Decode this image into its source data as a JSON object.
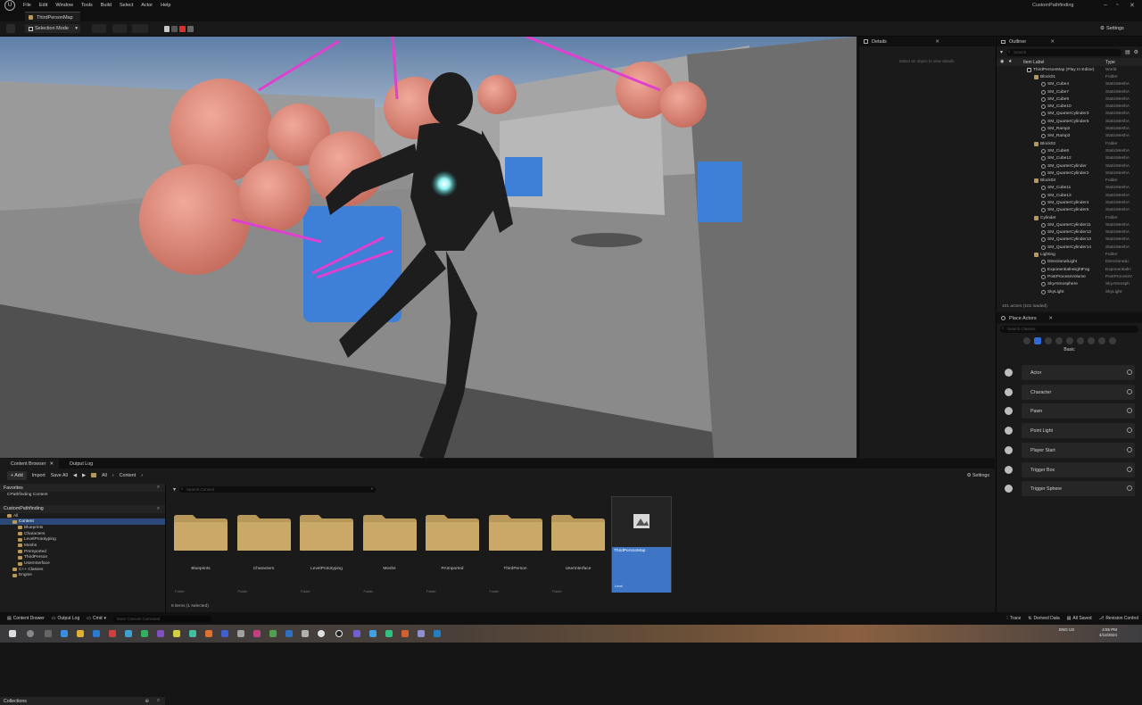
{
  "menubar": {
    "logo": "U",
    "items": [
      "File",
      "Edit",
      "Window",
      "Tools",
      "Build",
      "Select",
      "Actor",
      "Help"
    ],
    "project_name": "CustomPathfinding"
  },
  "tab": {
    "label": "ThirdPersonMap"
  },
  "toolbar": {
    "selection_mode": "Selection Mode",
    "settings": "Settings"
  },
  "details": {
    "title": "Details",
    "hint": "Select an object to view details."
  },
  "outliner": {
    "title": "Outliner",
    "search_placeholder": "Search",
    "col_label": "Item Label",
    "col_type": "Type",
    "rows": [
      {
        "label": "ThirdPersonMap (Play In Editor)",
        "type": "World",
        "indent": 0,
        "icon": "world"
      },
      {
        "label": "Block01",
        "type": "Folder",
        "indent": 1,
        "icon": "folder"
      },
      {
        "label": "SM_Cube4",
        "type": "StaticMeshA",
        "indent": 2,
        "icon": "mesh"
      },
      {
        "label": "SM_Cube7",
        "type": "StaticMeshA",
        "indent": 2,
        "icon": "mesh"
      },
      {
        "label": "SM_Cube9",
        "type": "StaticMeshA",
        "indent": 2,
        "icon": "mesh"
      },
      {
        "label": "SM_Cube10",
        "type": "StaticMeshA",
        "indent": 2,
        "icon": "mesh"
      },
      {
        "label": "SM_QuarterCylinder3",
        "type": "StaticMeshA",
        "indent": 2,
        "icon": "mesh"
      },
      {
        "label": "SM_QuarterCylinder5",
        "type": "StaticMeshA",
        "indent": 2,
        "icon": "mesh"
      },
      {
        "label": "SM_Ramp2",
        "type": "StaticMeshA",
        "indent": 2,
        "icon": "mesh"
      },
      {
        "label": "SM_Ramp3",
        "type": "StaticMeshA",
        "indent": 2,
        "icon": "mesh"
      },
      {
        "label": "Block02",
        "type": "Folder",
        "indent": 1,
        "icon": "folder"
      },
      {
        "label": "SM_Cube8",
        "type": "StaticMeshA",
        "indent": 2,
        "icon": "mesh"
      },
      {
        "label": "SM_Cube12",
        "type": "StaticMeshA",
        "indent": 2,
        "icon": "mesh"
      },
      {
        "label": "SM_QuarterCylinder",
        "type": "StaticMeshA",
        "indent": 2,
        "icon": "mesh"
      },
      {
        "label": "SM_QuarterCylinder2",
        "type": "StaticMeshA",
        "indent": 2,
        "icon": "mesh"
      },
      {
        "label": "Block03",
        "type": "Folder",
        "indent": 1,
        "icon": "folder"
      },
      {
        "label": "SM_Cube11",
        "type": "StaticMeshA",
        "indent": 2,
        "icon": "mesh"
      },
      {
        "label": "SM_Cube13",
        "type": "StaticMeshA",
        "indent": 2,
        "icon": "mesh"
      },
      {
        "label": "SM_QuarterCylinder4",
        "type": "StaticMeshA",
        "indent": 2,
        "icon": "mesh"
      },
      {
        "label": "SM_QuarterCylinder5",
        "type": "StaticMeshA",
        "indent": 2,
        "icon": "mesh"
      },
      {
        "label": "Cylinder",
        "type": "Folder",
        "indent": 1,
        "icon": "folder"
      },
      {
        "label": "SM_QuarterCylinder11",
        "type": "StaticMeshA",
        "indent": 2,
        "icon": "mesh"
      },
      {
        "label": "SM_QuarterCylinder12",
        "type": "StaticMeshA",
        "indent": 2,
        "icon": "mesh"
      },
      {
        "label": "SM_QuarterCylinder13",
        "type": "StaticMeshA",
        "indent": 2,
        "icon": "mesh"
      },
      {
        "label": "SM_QuarterCylinder14",
        "type": "StaticMeshA",
        "indent": 2,
        "icon": "mesh"
      },
      {
        "label": "Lighting",
        "type": "Folder",
        "indent": 1,
        "icon": "folder"
      },
      {
        "label": "DirectionalLight",
        "type": "DirectionalLi",
        "indent": 2,
        "icon": "mesh"
      },
      {
        "label": "ExponentialHeightFog",
        "type": "ExponentialH",
        "indent": 2,
        "icon": "mesh"
      },
      {
        "label": "PostProcessVolume",
        "type": "PostProcessV",
        "indent": 2,
        "icon": "mesh"
      },
      {
        "label": "SkyAtmosphere",
        "type": "SkyAtmosph",
        "indent": 2,
        "icon": "mesh"
      },
      {
        "label": "SkyLight",
        "type": "SkyLight",
        "indent": 2,
        "icon": "mesh"
      }
    ],
    "status": "101 actors (101 loaded)"
  },
  "place_actors": {
    "title": "Place Actors",
    "search_placeholder": "Search Classes",
    "category": "Basic",
    "items": [
      "Actor",
      "Character",
      "Pawn",
      "Point Light",
      "Player Start",
      "Trigger Box",
      "Trigger Sphere"
    ]
  },
  "content_browser": {
    "tab_label": "Content Browser",
    "output_tab": "Output Log",
    "add_label": "+ Add",
    "import_label": "Import",
    "save_all_label": "Save All",
    "path": [
      "All",
      "Content"
    ],
    "settings": "Settings",
    "favorites_label": "Favorites",
    "favorite_item": "CPathfinding Content",
    "project_label": "CustomPathfinding",
    "tree": [
      {
        "label": "All",
        "indent": 0
      },
      {
        "label": "Content",
        "indent": 1,
        "selected": true
      },
      {
        "label": "Blueprints",
        "indent": 2
      },
      {
        "label": "Characters",
        "indent": 2
      },
      {
        "label": "LevelPrototyping",
        "indent": 2
      },
      {
        "label": "Meshs",
        "indent": 2
      },
      {
        "label": "PAImported",
        "indent": 2
      },
      {
        "label": "ThirdPerson",
        "indent": 2
      },
      {
        "label": "UserInterface",
        "indent": 2
      },
      {
        "label": "C++ Classes",
        "indent": 1
      },
      {
        "label": "Engine",
        "indent": 1
      }
    ],
    "collections_label": "Collections",
    "search_placeholder": "Search Content",
    "folders": [
      "Blueprints",
      "Characters",
      "LevelPrototyping",
      "Meshs",
      "PAImported",
      "ThirdPerson",
      "UserInterface"
    ],
    "folder_kind": "Folder",
    "asset": {
      "name": "ThirdPersonMap",
      "kind": "Level"
    },
    "item_count": "8 items (1 selected)"
  },
  "statusbar": {
    "content_drawer": "Content Drawer",
    "output_log": "Output Log",
    "cmd": "Cmd",
    "cmd_placeholder": "Enter Console Command",
    "trace": "Trace",
    "derived_data": "Derived Data",
    "all_saved": "All Saved",
    "revision_control": "Revision Control"
  },
  "taskbar": {
    "lang": "ENG US",
    "time": "4:55 PM",
    "date": "4/12/2024"
  },
  "colors": {
    "accent": "#2f6ad6",
    "folder": "#b8985a",
    "selected_asset": "#3e75c4"
  }
}
